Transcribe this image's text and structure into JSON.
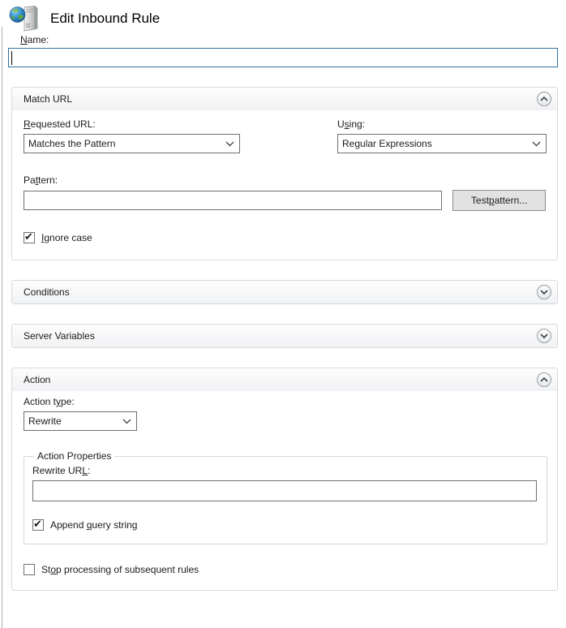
{
  "window": {
    "title": "Edit Inbound Rule",
    "icon": "iis-site-icon"
  },
  "name_field": {
    "label": "&Name:",
    "value": "",
    "focused": true
  },
  "sections": {
    "match_url": {
      "title": "Match URL",
      "expanded": true,
      "chevron_icon": "chevron-up-icon",
      "requested_url": {
        "label": "&Requested URL:",
        "value": "Matches the Pattern"
      },
      "using": {
        "label": "U&sing:",
        "value": "Regular Expressions"
      },
      "pattern": {
        "label": "Pa&ttern:",
        "value": ""
      },
      "test_pattern_button": "Test &pattern...",
      "ignore_case": {
        "label": "&Ignore case",
        "checked": true
      }
    },
    "conditions": {
      "title": "Conditions",
      "expanded": false,
      "chevron_icon": "chevron-down-icon"
    },
    "server_variables": {
      "title": "Server Variables",
      "expanded": false,
      "chevron_icon": "chevron-down-icon"
    },
    "action": {
      "title": "Action",
      "expanded": true,
      "chevron_icon": "chevron-up-icon",
      "action_type": {
        "label": "Action t&ype:",
        "value": "Rewrite"
      },
      "action_properties": {
        "title": "Action Properties",
        "rewrite_url": {
          "label": "Rewrite UR&L:",
          "value": ""
        },
        "append_query_string": {
          "label": "Append &query string",
          "checked": true
        }
      },
      "stop_processing": {
        "label": "St&op processing of subsequent rules",
        "checked": false
      }
    }
  },
  "colors": {
    "focused_input_border": "#35709b",
    "control_border": "#707070",
    "panel_border": "#d6dade",
    "button_background": "#e2e2e2",
    "header_gradient_bottom": "#f1f2f4"
  }
}
